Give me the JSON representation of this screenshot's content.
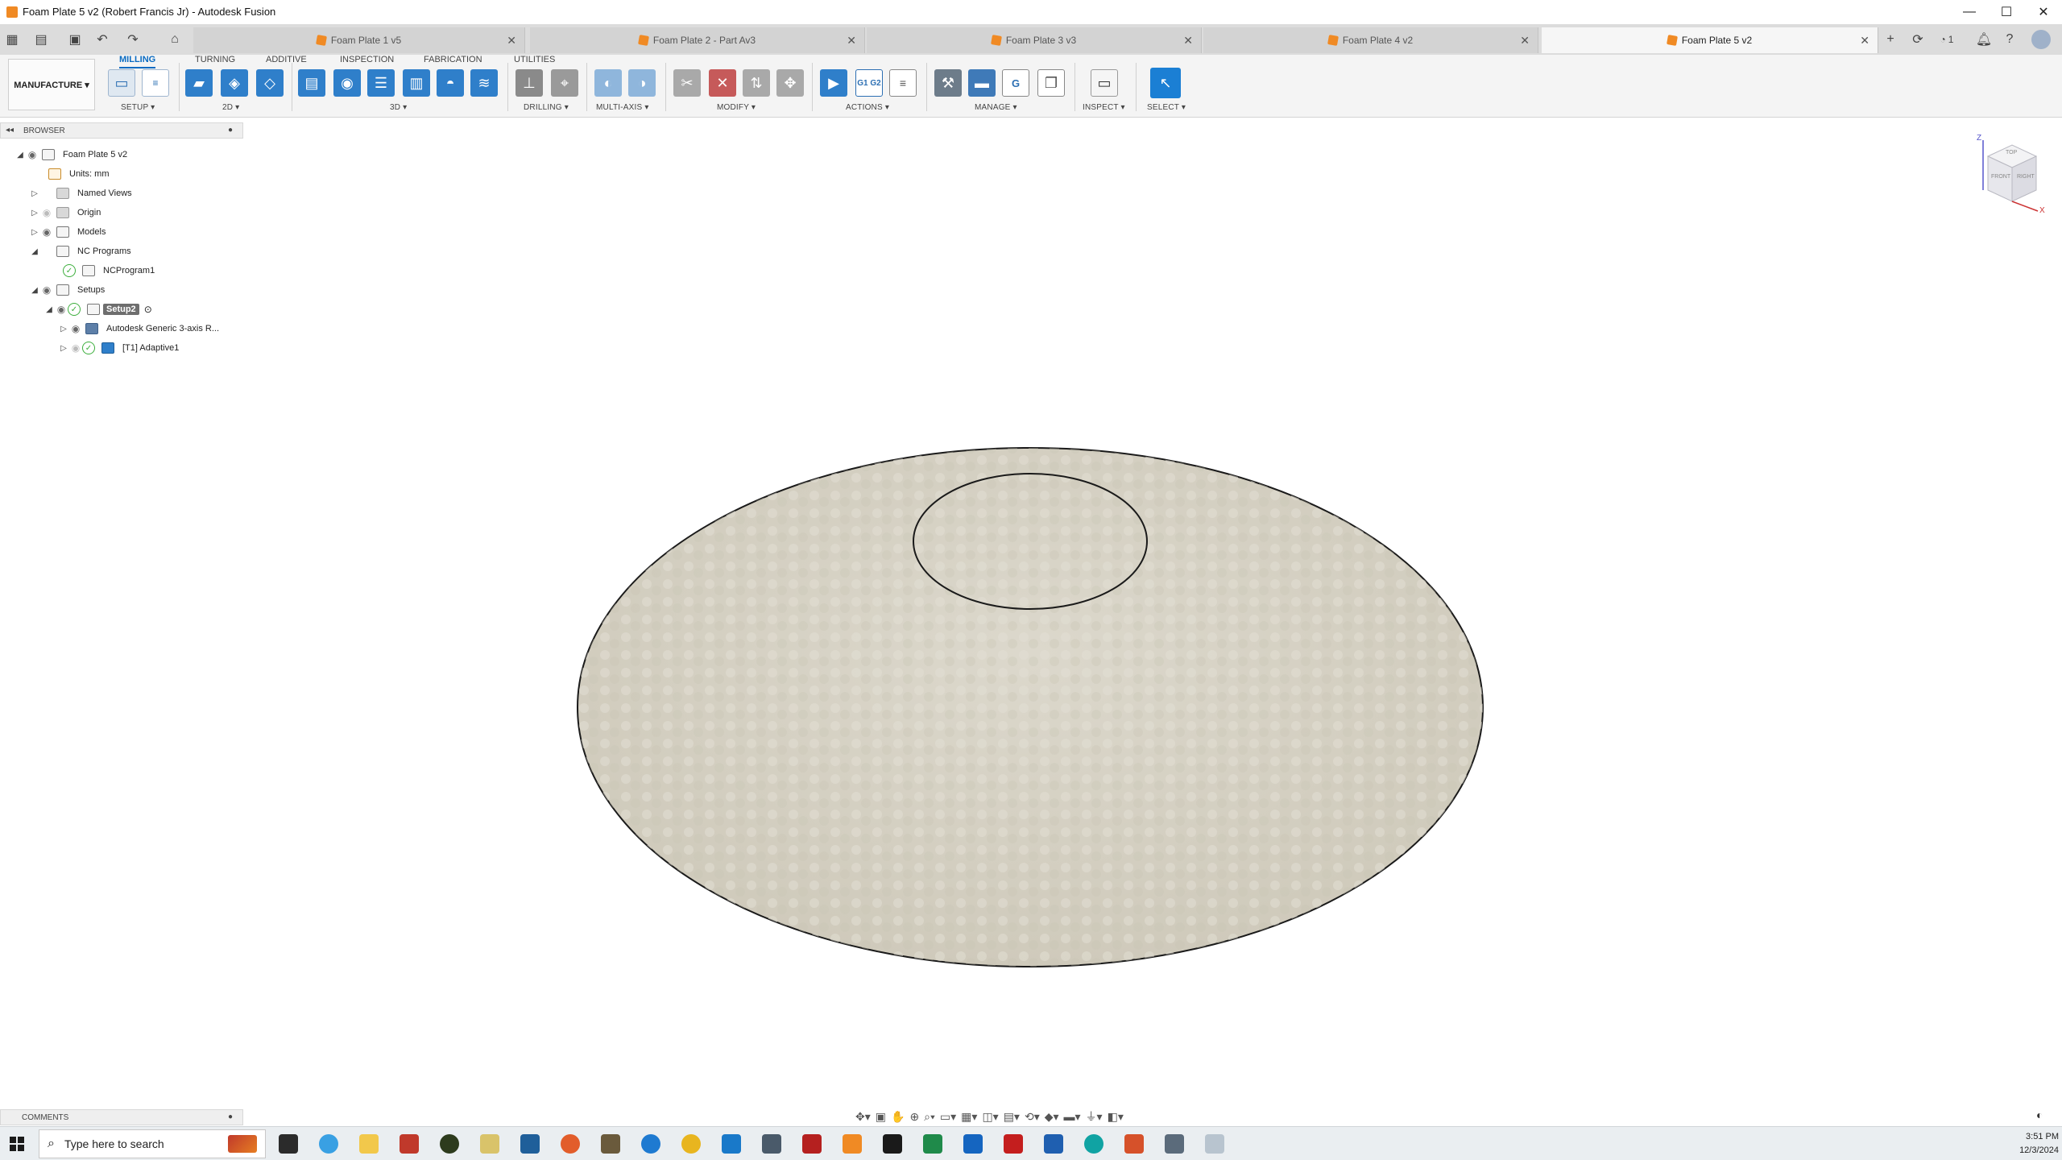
{
  "window": {
    "title": "Foam Plate 5 v2 (Robert Francis Jr) - Autodesk Fusion",
    "controls": {
      "minimize": "—",
      "maximize": "☐",
      "close": "✕"
    }
  },
  "tabs": [
    {
      "label": "Foam Plate 1 v5",
      "active": false
    },
    {
      "label": "Foam Plate 2 - Part Av3",
      "active": false
    },
    {
      "label": "Foam Plate 3 v3",
      "active": false
    },
    {
      "label": "Foam Plate 4 v2",
      "active": false
    },
    {
      "label": "Foam Plate 5 v2",
      "active": true
    }
  ],
  "job_count": "1",
  "ribbon": {
    "workspace": "MANUFACTURE ▾",
    "tabs": [
      "MILLING",
      "TURNING",
      "ADDITIVE",
      "INSPECTION",
      "FABRICATION",
      "UTILITIES"
    ],
    "groups": [
      "SETUP ▾",
      "2D ▾",
      "3D ▾",
      "DRILLING ▾",
      "MULTI-AXIS ▾",
      "MODIFY ▾",
      "ACTIONS ▾",
      "MANAGE ▾",
      "INSPECT ▾",
      "SELECT ▾"
    ],
    "actions_icon_text": "G1 G2"
  },
  "browser": {
    "header": "BROWSER",
    "items": [
      {
        "label": "Foam Plate 5 v2"
      },
      {
        "label": "Units: mm"
      },
      {
        "label": "Named Views"
      },
      {
        "label": "Origin"
      },
      {
        "label": "Models"
      },
      {
        "label": "NC Programs"
      },
      {
        "label": "NCProgram1"
      },
      {
        "label": "Setups"
      },
      {
        "label": "Setup2"
      },
      {
        "label": "Autodesk Generic 3-axis R..."
      },
      {
        "label": "[T1] Adaptive1"
      }
    ]
  },
  "viewcube": {
    "faces": [
      "TOP",
      "FRONT",
      "RIGHT"
    ],
    "axes": [
      "Z",
      "X"
    ]
  },
  "comments": {
    "header": "COMMENTS"
  },
  "taskbar": {
    "search_placeholder": "Type here to search",
    "time": "3:51 PM",
    "date": "12/3/2024"
  },
  "colors": {
    "accent": "#0a6bc2",
    "plate": "#d8d3c5",
    "orange_doc": "#f08a24",
    "check_green": "#3cae3c"
  }
}
